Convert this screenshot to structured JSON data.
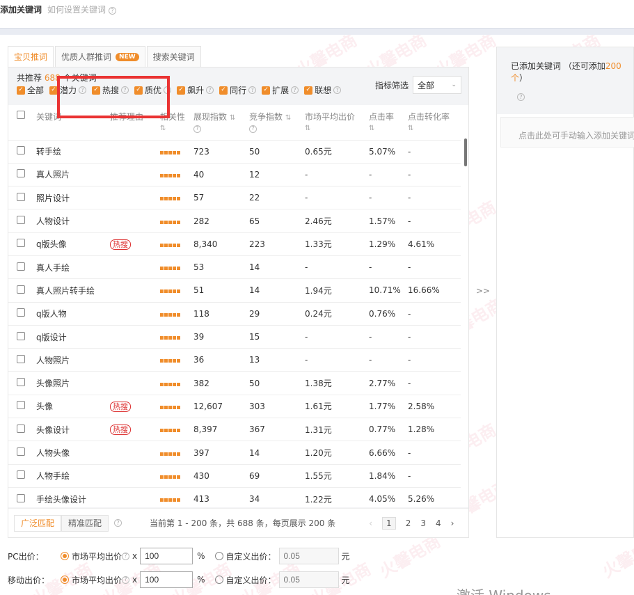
{
  "header": {
    "title": "添加关键词",
    "help": "如何设置关键词"
  },
  "tabs": [
    {
      "label": "宝贝推词"
    },
    {
      "label": "优质人群推词",
      "badge": "NEW"
    },
    {
      "label": "搜索关键词"
    }
  ],
  "summary": {
    "prefix": "共推荐",
    "count": "688",
    "suffix": "个关键词"
  },
  "filters": [
    "全部",
    "潜力",
    "热搜",
    "质优",
    "飙升",
    "同行",
    "扩展",
    "联想"
  ],
  "metric_filter": {
    "label": "指标筛选",
    "value": "全部"
  },
  "columns": [
    "关键词",
    "推荐理由",
    "相关性",
    "展现指数",
    "竞争指数",
    "市场平均出价",
    "点击率",
    "点击转化率"
  ],
  "rows": [
    {
      "kw": "转手绘",
      "hot": false,
      "show": "723",
      "comp": "50",
      "price": "0.65元",
      "ctr": "5.07%",
      "cvr": "-"
    },
    {
      "kw": "真人照片",
      "hot": false,
      "show": "40",
      "comp": "12",
      "price": "-",
      "ctr": "-",
      "cvr": "-"
    },
    {
      "kw": "照片设计",
      "hot": false,
      "show": "57",
      "comp": "22",
      "price": "-",
      "ctr": "-",
      "cvr": "-"
    },
    {
      "kw": "人物设计",
      "hot": false,
      "show": "282",
      "comp": "65",
      "price": "2.46元",
      "ctr": "1.57%",
      "cvr": "-"
    },
    {
      "kw": "q版头像",
      "hot": true,
      "show": "8,340",
      "comp": "223",
      "price": "1.33元",
      "ctr": "1.29%",
      "cvr": "4.61%"
    },
    {
      "kw": "真人手绘",
      "hot": false,
      "show": "53",
      "comp": "14",
      "price": "-",
      "ctr": "-",
      "cvr": "-"
    },
    {
      "kw": "真人照片转手绘",
      "hot": false,
      "show": "51",
      "comp": "14",
      "price": "1.94元",
      "ctr": "10.71%",
      "cvr": "16.66%"
    },
    {
      "kw": "q版人物",
      "hot": false,
      "show": "118",
      "comp": "29",
      "price": "0.24元",
      "ctr": "0.76%",
      "cvr": "-"
    },
    {
      "kw": "q版设计",
      "hot": false,
      "show": "39",
      "comp": "15",
      "price": "-",
      "ctr": "-",
      "cvr": "-"
    },
    {
      "kw": "人物照片",
      "hot": false,
      "show": "36",
      "comp": "13",
      "price": "-",
      "ctr": "-",
      "cvr": "-"
    },
    {
      "kw": "头像照片",
      "hot": false,
      "show": "382",
      "comp": "50",
      "price": "1.38元",
      "ctr": "2.77%",
      "cvr": "-"
    },
    {
      "kw": "头像",
      "hot": true,
      "show": "12,607",
      "comp": "303",
      "price": "1.61元",
      "ctr": "1.77%",
      "cvr": "2.58%"
    },
    {
      "kw": "头像设计",
      "hot": true,
      "show": "8,397",
      "comp": "367",
      "price": "1.31元",
      "ctr": "0.77%",
      "cvr": "1.28%"
    },
    {
      "kw": "人物头像",
      "hot": false,
      "show": "397",
      "comp": "14",
      "price": "1.20元",
      "ctr": "6.66%",
      "cvr": "-"
    },
    {
      "kw": "人物手绘",
      "hot": false,
      "show": "430",
      "comp": "69",
      "price": "1.55元",
      "ctr": "1.84%",
      "cvr": "-"
    },
    {
      "kw": "手绘头像设计",
      "hot": false,
      "show": "413",
      "comp": "34",
      "price": "1.22元",
      "ctr": "4.05%",
      "cvr": "5.26%"
    }
  ],
  "hot_label": "热搜",
  "footer": {
    "broad": "广泛匹配",
    "exact": "精准匹配",
    "pager_info": "当前第 1 - 200 条，共 688 条，每页展示 200 条",
    "pages": [
      "1",
      "2",
      "3",
      "4"
    ]
  },
  "right_panel": {
    "title_prefix": "已添加关键词 （还可添加",
    "remaining": "200个",
    "title_suffix": "）",
    "input_placeholder": "点击此处可手动输入添加关键词"
  },
  "arrow": ">>",
  "bid": {
    "pc_label": "PC出价：",
    "mobile_label": "移动出价：",
    "market_label": "市场平均出价",
    "multiplier": "x",
    "value": "100",
    "percent": "%",
    "custom_label": "自定义出价：",
    "custom_placeholder": "0.05",
    "yuan": "元"
  },
  "os_watermark": "激活 Windows",
  "watermark": "火馨电商",
  "colors": {
    "accent": "#f08d2b",
    "hot": "#d33333",
    "highlight_box": "#ea3333"
  }
}
